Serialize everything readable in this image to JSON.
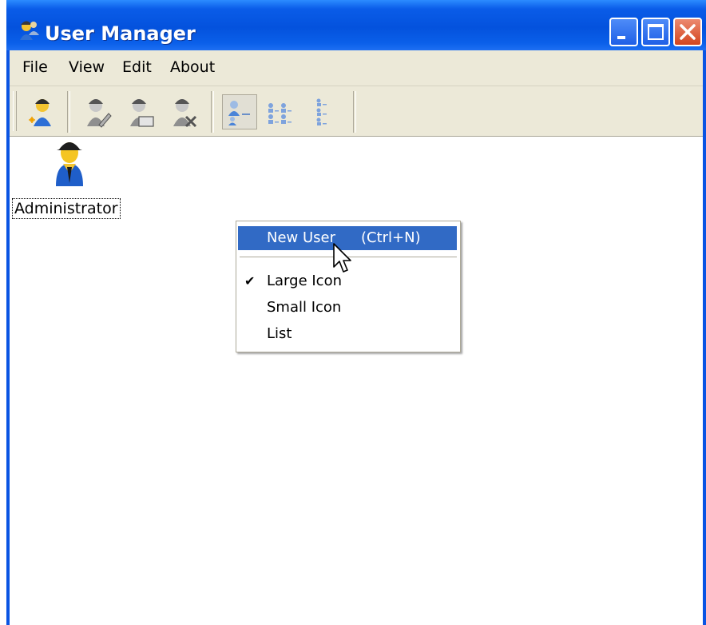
{
  "window": {
    "title": "User Manager",
    "app_icon": "user-manager-icon",
    "controls": [
      "minimize-icon",
      "maximize-icon",
      "close-icon"
    ]
  },
  "menubar": {
    "items": [
      {
        "label": "File"
      },
      {
        "label": "View"
      },
      {
        "label": "Edit"
      },
      {
        "label": "About"
      }
    ]
  },
  "toolbar": {
    "buttons": [
      {
        "icon": "new-user-icon"
      },
      {
        "icon": "edit-user-icon"
      },
      {
        "icon": "user-properties-icon"
      },
      {
        "icon": "delete-user-icon"
      },
      {
        "icon": "large-icon-view-icon",
        "pressed": true
      },
      {
        "icon": "small-icon-view-icon"
      },
      {
        "icon": "list-view-icon"
      }
    ]
  },
  "client": {
    "items": [
      {
        "label": "Administrator",
        "icon": "user-icon"
      }
    ]
  },
  "context_menu": {
    "items": [
      {
        "label": "New User",
        "shortcut": "(Ctrl+N)",
        "highlighted": true
      },
      {
        "label": "Large Icon",
        "checked": true,
        "check_mark": "✔"
      },
      {
        "label": "Small Icon"
      },
      {
        "label": "List"
      }
    ]
  },
  "colors": {
    "titlebar": "#0a54e3",
    "menu_highlight": "#316ac5",
    "chrome": "#ece9d8"
  }
}
